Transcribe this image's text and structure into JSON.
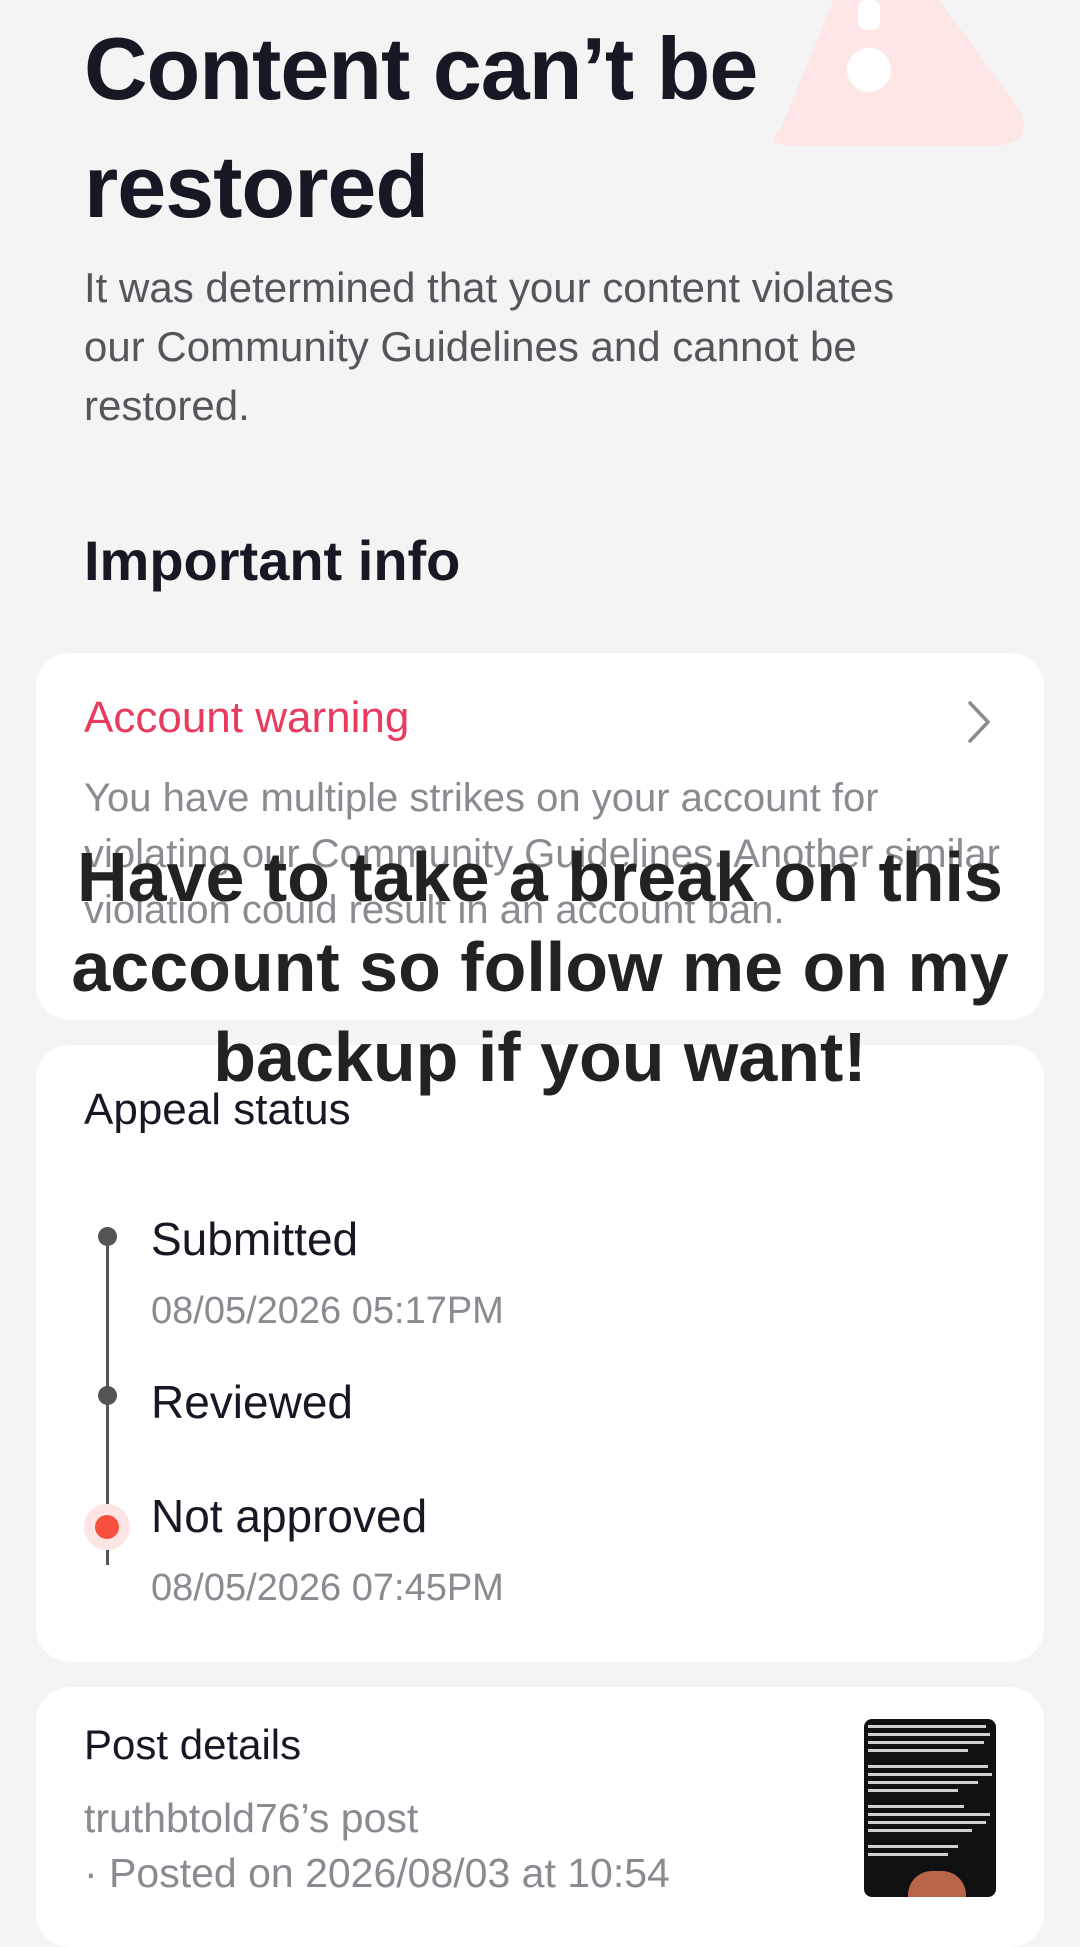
{
  "header": {
    "title": "Content can’t be restored",
    "description": "It was determined that your content violates our Community Guidelines and cannot be restored."
  },
  "important_info": {
    "heading": "Important info",
    "account_warning": {
      "title": "Account warning",
      "body": "You have multiple strikes on your account for violating our Community Guidelines. Another similar violation could result in an account ban."
    }
  },
  "appeal": {
    "title": "Appeal status",
    "steps": [
      {
        "label": "Submitted",
        "date": "08/05/2026 05:17PM"
      },
      {
        "label": "Reviewed",
        "date": ""
      },
      {
        "label": "Not approved",
        "date": "08/05/2026 07:45PM"
      }
    ]
  },
  "post": {
    "title": "Post details",
    "author": "truthbtold76’s post",
    "posted": "· Posted on 2026/08/03 at 10:54"
  },
  "overlay": {
    "caption": "Have to take a break on this account so follow me on my backup if you want!"
  },
  "colors": {
    "warning": "#e83b5d",
    "not_approved_dot": "#f7503f",
    "background": "#f4f4f4"
  }
}
